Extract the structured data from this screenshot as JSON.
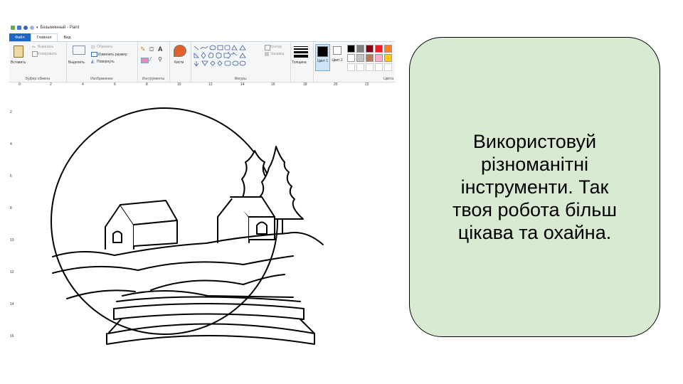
{
  "window": {
    "title": "Безымянный - Paint"
  },
  "tabs": [
    {
      "label": "Файл"
    },
    {
      "label": "Главная"
    },
    {
      "label": "Вид"
    }
  ],
  "ribbon": {
    "clipboard": {
      "paste": "Вставить",
      "cut": "Вырезать",
      "copy": "Копировать",
      "group": "Буфер обмена"
    },
    "image": {
      "select": "Выделить",
      "crop": "Обрезать",
      "resize": "Изменить размер",
      "rotate": "Повернуть",
      "group": "Изображение"
    },
    "tools": {
      "group": "Инструменты"
    },
    "brushes": {
      "label": "Кисти"
    },
    "shapes": {
      "outline": "Контур",
      "fill": "Заливка",
      "group": "Фигуры"
    },
    "size": {
      "label": "Толщина"
    },
    "color1": {
      "label": "Цвет 1"
    },
    "color2": {
      "label": "Цвет 2"
    },
    "colors": {
      "group": "Цвета",
      "palette_row1": [
        "#000000",
        "#7f7f7f",
        "#880015",
        "#ed1c24",
        "#ff7f27"
      ],
      "palette_row2": [
        "#ffffff",
        "#c3c3c3",
        "#b97a57",
        "#ffaec9",
        "#ffc90e"
      ]
    }
  },
  "ruler": {
    "marks": [
      "0",
      "2",
      "4",
      "6",
      "8",
      "10",
      "12",
      "14",
      "16",
      "18",
      "20",
      "22"
    ]
  },
  "vruler": {
    "marks": [
      "2",
      "4",
      "6",
      "8",
      "10",
      "12",
      "14",
      "16"
    ]
  },
  "hint": {
    "text": "Використовуй\nрізноманітні\nінструменти. Так\nтвоя робота більш\nцікава та охайна."
  }
}
